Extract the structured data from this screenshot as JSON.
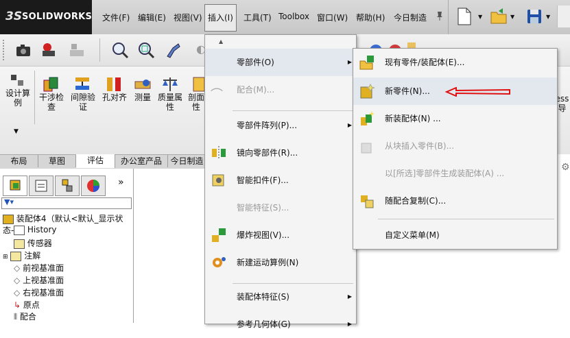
{
  "app": {
    "logo_mark": "3S",
    "logo_text": "SOLIDWORKS"
  },
  "menubar": [
    "文件(F)",
    "编辑(E)",
    "视图(V)",
    "插入(I)",
    "工具(T)",
    "Toolbox",
    "窗口(W)",
    "帮助(H)",
    "今日制造"
  ],
  "ribbon": {
    "buttons": [
      {
        "label1": "设计算",
        "label2": "例"
      },
      {
        "label1": "干涉检",
        "label2": "查"
      },
      {
        "label1": "间隙验",
        "label2": "证"
      },
      {
        "label1": "孔对齐",
        "label2": ""
      },
      {
        "label1": "测量",
        "label2": ""
      },
      {
        "label1": "质量属",
        "label2": "性"
      },
      {
        "label1": "剖面",
        "label2": "性"
      }
    ],
    "right_label1": "ess",
    "right_label2": "导"
  },
  "tabs": [
    "布局",
    "草图",
    "评估",
    "办公室产品",
    "今日制造"
  ],
  "feature_tree": {
    "root": "装配体4（默认<默认_显示状态-",
    "items": [
      "History",
      "传感器",
      "注解",
      "前视基准面",
      "上视基准面",
      "右视基准面",
      "原点",
      "配合"
    ]
  },
  "insert_menu": {
    "items": [
      "零部件(O)",
      "配合(M)...",
      "零部件阵列(P)...",
      "镜向零部件(R)...",
      "智能扣件(F)...",
      "智能特征(S)...",
      "爆炸视图(V)...",
      "新建运动算例(N)",
      "装配体特征(S)",
      "参考几何体(G)"
    ]
  },
  "component_submenu": {
    "items": [
      "现有零件/装配体(E)...",
      "新零件(N)...",
      "新装配体(N) ...",
      "从块插入零件(B)...",
      "以[所选]零部件生成装配体(A) ...",
      "随配合复制(C)...",
      "自定义菜单(M)"
    ]
  },
  "colors": {
    "logo_bg": "#1a1a1a",
    "annotation_arrow": "#e01010",
    "highlight": "#e3e7ee"
  }
}
